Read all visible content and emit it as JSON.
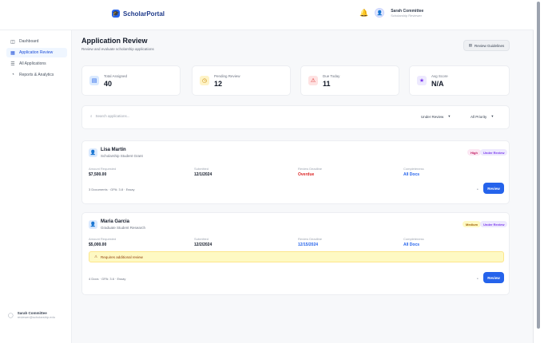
{
  "app": {
    "name": "ScholarPortal",
    "logo_icon": "🎓"
  },
  "header": {
    "notification_icon": "bell-icon",
    "user_name": "Sarah Committee",
    "user_role": "Scholarship Reviewer"
  },
  "sidebar": {
    "items": [
      {
        "label": "Dashboard",
        "icon": "◫"
      },
      {
        "label": "Application Review",
        "icon": "▦",
        "active": true
      },
      {
        "label": "All Applications",
        "icon": "☰"
      },
      {
        "label": "Reports & Analytics",
        "icon": "◔"
      }
    ],
    "footer_user": {
      "name": "Sarah Committee",
      "email": "reviewer@scholarship.edu"
    }
  },
  "page": {
    "title": "Application Review",
    "subtitle": "Review and evaluate scholarship applications",
    "export_label": "Review Guidelines"
  },
  "stats": [
    {
      "label": "Total Assigned",
      "value": "40",
      "icon": "▤",
      "color": "#2563eb",
      "bg": "#dbeafe"
    },
    {
      "label": "Pending Review",
      "value": "12",
      "icon": "◷",
      "color": "#ca8a04",
      "bg": "#fef3c7"
    },
    {
      "label": "Due Today",
      "value": "11",
      "icon": "⚠",
      "color": "#dc2626",
      "bg": "#fee2e2"
    },
    {
      "label": "Avg Score",
      "value": "N/A",
      "icon": "★",
      "color": "#7c3aed",
      "bg": "#ede9fe"
    }
  ],
  "filters": {
    "search_placeholder": "Search applications...",
    "sort_value": "Under Review",
    "priority_value": "All Priority"
  },
  "applications": [
    {
      "name": "Lisa Martin",
      "program": "Scholarship Student Grant",
      "badges": [
        {
          "label": "High",
          "color": "#be185d",
          "bg": "#fce7f3"
        },
        {
          "label": "Under Review",
          "color": "#7c3aed",
          "bg": "#ede9fe"
        }
      ],
      "fields": [
        {
          "label": "Amount Requested",
          "value": "$7,500.00",
          "tone": ""
        },
        {
          "label": "Submitted",
          "value": "12/1/2024",
          "tone": ""
        },
        {
          "label": "Review Deadline",
          "value": "Overdue",
          "tone": "red"
        },
        {
          "label": "Completeness",
          "value": "All Docs",
          "tone": "blue"
        }
      ],
      "meta": "3 Documents  ·  GPA: 3.8  ·  Essay",
      "review_label": "Review"
    },
    {
      "name": "Maria Garcia",
      "program": "Graduate Student Research",
      "badges": [
        {
          "label": "Medium",
          "color": "#a16207",
          "bg": "#fef9c3"
        },
        {
          "label": "Under Review",
          "color": "#7c3aed",
          "bg": "#ede9fe"
        }
      ],
      "fields": [
        {
          "label": "Amount Requested",
          "value": "$5,000.00",
          "tone": ""
        },
        {
          "label": "Submitted",
          "value": "12/2/2024",
          "tone": ""
        },
        {
          "label": "Review Deadline",
          "value": "12/15/2024",
          "tone": "blue"
        },
        {
          "label": "Completeness",
          "value": "All Docs",
          "tone": "blue"
        }
      ],
      "alert": "Requires additional review",
      "meta": "4 Docs  ·  GPA: 3.6  ·  Essay",
      "review_label": "Review"
    }
  ]
}
